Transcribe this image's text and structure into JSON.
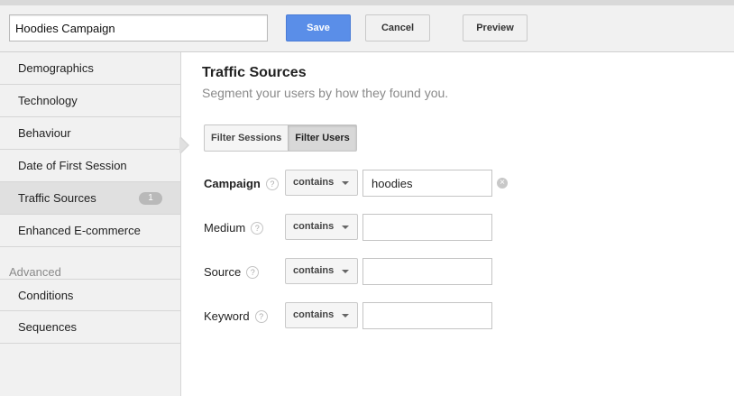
{
  "header": {
    "segment_name": "Hoodies Campaign",
    "save_label": "Save",
    "cancel_label": "Cancel",
    "preview_label": "Preview"
  },
  "sidebar": {
    "items": [
      {
        "label": "Demographics"
      },
      {
        "label": "Technology"
      },
      {
        "label": "Behaviour"
      },
      {
        "label": "Date of First Session"
      },
      {
        "label": "Traffic Sources",
        "badge": "1",
        "active": true
      },
      {
        "label": "Enhanced E-commerce"
      }
    ],
    "advanced_label": "Advanced",
    "advanced_items": [
      {
        "label": "Conditions"
      },
      {
        "label": "Sequences"
      }
    ]
  },
  "main": {
    "title": "Traffic Sources",
    "subtitle": "Segment your users by how they found you.",
    "filter_sessions_label": "Filter Sessions",
    "filter_users_label": "Filter Users",
    "rows": [
      {
        "label": "Campaign",
        "operator": "contains",
        "value": "hoodies"
      },
      {
        "label": "Medium",
        "operator": "contains",
        "value": ""
      },
      {
        "label": "Source",
        "operator": "contains",
        "value": ""
      },
      {
        "label": "Keyword",
        "operator": "contains",
        "value": ""
      }
    ]
  },
  "icons": {
    "help": "?",
    "clear": "×"
  },
  "colors": {
    "primary_button": "#5a8ee8",
    "sidebar_bg": "#f1f1f1",
    "active_item": "#e0e0e0"
  }
}
